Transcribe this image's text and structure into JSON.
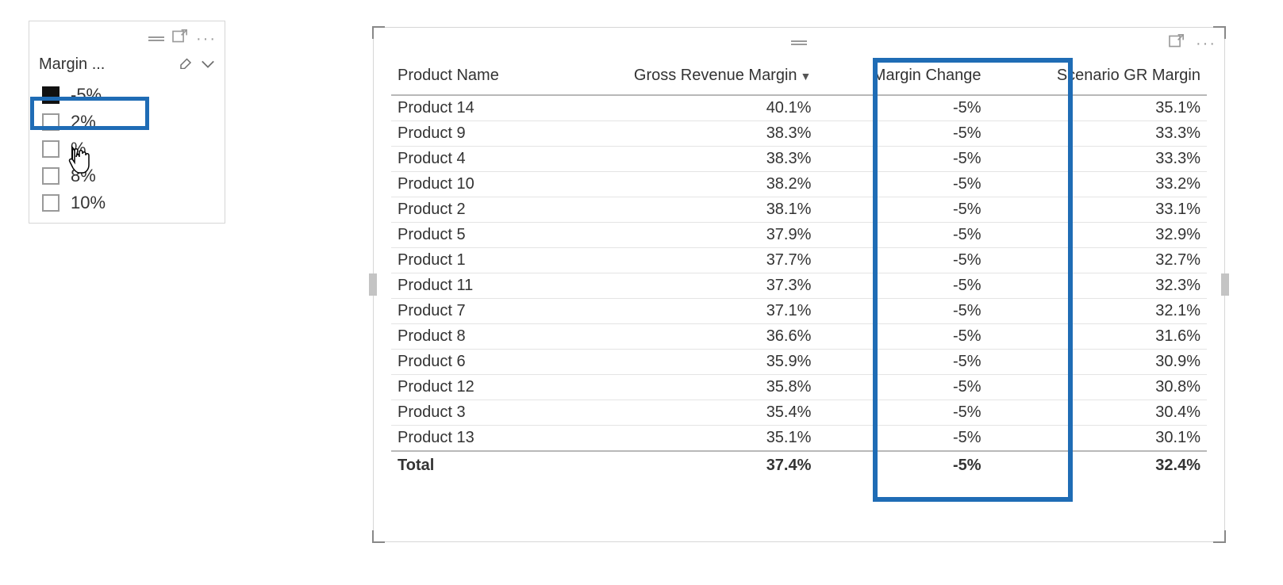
{
  "slicer": {
    "title": "Margin ...",
    "items": [
      {
        "label": "-5%",
        "checked": true
      },
      {
        "label": "2%",
        "checked": false
      },
      {
        "label": "%",
        "checked": false
      },
      {
        "label": "8%",
        "checked": false
      },
      {
        "label": "10%",
        "checked": false
      }
    ]
  },
  "table": {
    "columns": {
      "product_name": "Product Name",
      "gross_margin": "Gross Revenue Margin",
      "margin_change": "Margin Change",
      "scenario_margin": "Scenario GR Margin"
    },
    "rows": [
      {
        "name": "Product 14",
        "gross": "40.1%",
        "change": "-5%",
        "scenario": "35.1%"
      },
      {
        "name": "Product 9",
        "gross": "38.3%",
        "change": "-5%",
        "scenario": "33.3%"
      },
      {
        "name": "Product 4",
        "gross": "38.3%",
        "change": "-5%",
        "scenario": "33.3%"
      },
      {
        "name": "Product 10",
        "gross": "38.2%",
        "change": "-5%",
        "scenario": "33.2%"
      },
      {
        "name": "Product 2",
        "gross": "38.1%",
        "change": "-5%",
        "scenario": "33.1%"
      },
      {
        "name": "Product 5",
        "gross": "37.9%",
        "change": "-5%",
        "scenario": "32.9%"
      },
      {
        "name": "Product 1",
        "gross": "37.7%",
        "change": "-5%",
        "scenario": "32.7%"
      },
      {
        "name": "Product 11",
        "gross": "37.3%",
        "change": "-5%",
        "scenario": "32.3%"
      },
      {
        "name": "Product 7",
        "gross": "37.1%",
        "change": "-5%",
        "scenario": "32.1%"
      },
      {
        "name": "Product 8",
        "gross": "36.6%",
        "change": "-5%",
        "scenario": "31.6%"
      },
      {
        "name": "Product 6",
        "gross": "35.9%",
        "change": "-5%",
        "scenario": "30.9%"
      },
      {
        "name": "Product 12",
        "gross": "35.8%",
        "change": "-5%",
        "scenario": "30.8%"
      },
      {
        "name": "Product 3",
        "gross": "35.4%",
        "change": "-5%",
        "scenario": "30.4%"
      },
      {
        "name": "Product 13",
        "gross": "35.1%",
        "change": "-5%",
        "scenario": "30.1%"
      }
    ],
    "total": {
      "name": "Total",
      "gross": "37.4%",
      "change": "-5%",
      "scenario": "32.4%"
    }
  },
  "highlight_color": "#1f6cb5"
}
